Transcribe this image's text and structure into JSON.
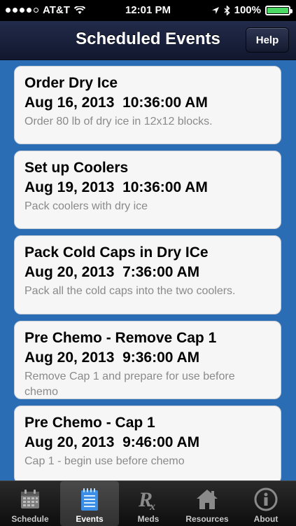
{
  "status_bar": {
    "carrier": "AT&T",
    "time": "12:01 PM",
    "battery": "100%"
  },
  "navbar": {
    "title": "Scheduled Events",
    "help_label": "Help"
  },
  "events": [
    {
      "title": "Order Dry Ice",
      "datetime": "Aug 16, 2013  10:36:00 AM",
      "description": "Order 80 lb of dry ice in 12x12 blocks."
    },
    {
      "title": "Set up Coolers",
      "datetime": "Aug 19, 2013  10:36:00 AM",
      "description": "Pack coolers with dry ice"
    },
    {
      "title": "Pack Cold Caps in Dry ICe",
      "datetime": "Aug 20, 2013  7:36:00 AM",
      "description": "Pack all the cold caps into the two coolers."
    },
    {
      "title": "Pre Chemo - Remove Cap 1",
      "datetime": "Aug 20, 2013  9:36:00 AM",
      "description": "Remove Cap 1 and prepare for use before chemo"
    },
    {
      "title": "Pre Chemo - Cap 1",
      "datetime": "Aug 20, 2013  9:46:00 AM",
      "description": "Cap 1 - begin use before chemo"
    }
  ],
  "tabbar": {
    "items": [
      {
        "label": "Schedule",
        "icon": "calendar-icon"
      },
      {
        "label": "Events",
        "icon": "notepad-icon",
        "active": true
      },
      {
        "label": "Meds",
        "icon": "rx-icon"
      },
      {
        "label": "Resources",
        "icon": "house-icon"
      },
      {
        "label": "About",
        "icon": "info-icon"
      }
    ]
  },
  "colors": {
    "background": "#2a6db5",
    "navbar": "#1a2140",
    "battery_fill": "#4cd964"
  }
}
